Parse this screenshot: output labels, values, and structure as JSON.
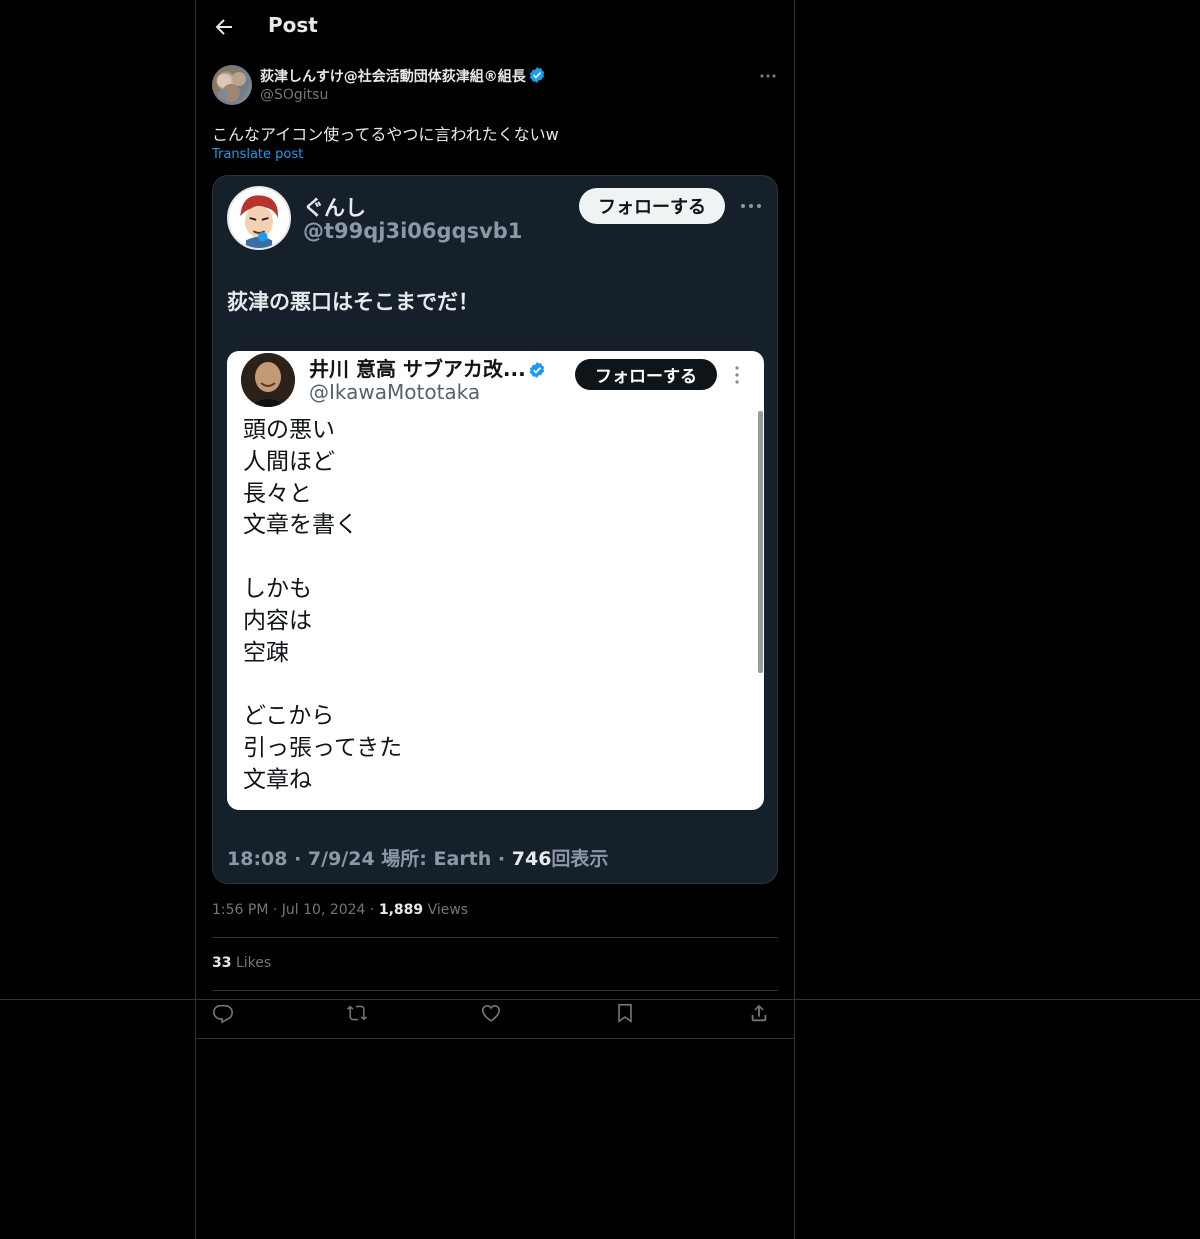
{
  "header": {
    "title": "Post"
  },
  "author": {
    "name": "荻津しんすけ@社会活動団体荻津組®組長",
    "handle": "@SOgitsu"
  },
  "post": {
    "text": "こんなアイコン使ってるやつに言われたくないw",
    "translate_label": "Translate post"
  },
  "embedded": {
    "name": "ぐんし",
    "handle": "@t99qj3i06gqsvb1",
    "follow_label": "フォローする",
    "text": "荻津の悪口はそこまでだ！",
    "inner": {
      "name": "井川 意高 サブアカ改...",
      "handle": "@IkawaMototaka",
      "follow_label": "フォローする",
      "body": "頭の悪い\n人間ほど\n長々と\n文章を書く\n\nしかも\n内容は\n空疎\n\nどこから\n引っ張ってきた\n文章ね"
    },
    "meta_prefix": "18:08 · 7/9/24 場所: Earth · ",
    "views_count": "746",
    "views_suffix": "回表示"
  },
  "meta": {
    "time": "1:56 PM",
    "date": "Jul 10, 2024",
    "views_count": "1,889",
    "views_label": "Views"
  },
  "likes": {
    "count": "33",
    "label": "Likes"
  },
  "icons": [
    "back-arrow-icon",
    "verified-badge-icon",
    "more-icon",
    "reply-icon",
    "repost-icon",
    "like-icon",
    "bookmark-icon",
    "share-icon"
  ],
  "colors": {
    "background": "#000000",
    "accent": "#1d9bf0",
    "text": "#e7e9ea",
    "muted": "#71767b",
    "card": "#15202b"
  }
}
